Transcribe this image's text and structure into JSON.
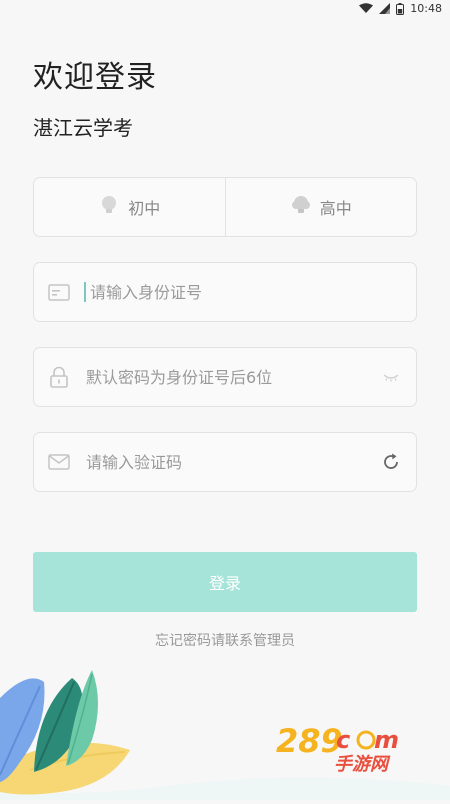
{
  "status_bar": {
    "time": "10:48",
    "icons": [
      "wifi-icon",
      "signal-icon",
      "battery-icon"
    ]
  },
  "header": {
    "title": "欢迎登录",
    "subtitle": "湛江云学考"
  },
  "level_selector": {
    "options": [
      {
        "label": "初中",
        "icon": "bulb-small-icon"
      },
      {
        "label": "高中",
        "icon": "bulb-large-icon"
      }
    ]
  },
  "form": {
    "id_field": {
      "placeholder": "请输入身份证号",
      "value": "",
      "icon": "id-card-icon"
    },
    "password_field": {
      "placeholder": "默认密码为身份证号后6位",
      "value": "",
      "icon": "lock-icon",
      "trail_icon": "eye-closed-icon"
    },
    "captcha_field": {
      "placeholder": "请输入验证码",
      "value": "",
      "icon": "mail-icon",
      "trail_icon": "refresh-icon"
    }
  },
  "actions": {
    "login_label": "登录",
    "forgot_label": "忘记密码请联系管理员"
  },
  "colors": {
    "accent": "#a6e3d8",
    "background": "#f7f7f7",
    "border": "#e2e2e2",
    "placeholder": "#9a9a9a"
  },
  "watermark": {
    "line1": "289.com",
    "line2": "手游网"
  }
}
